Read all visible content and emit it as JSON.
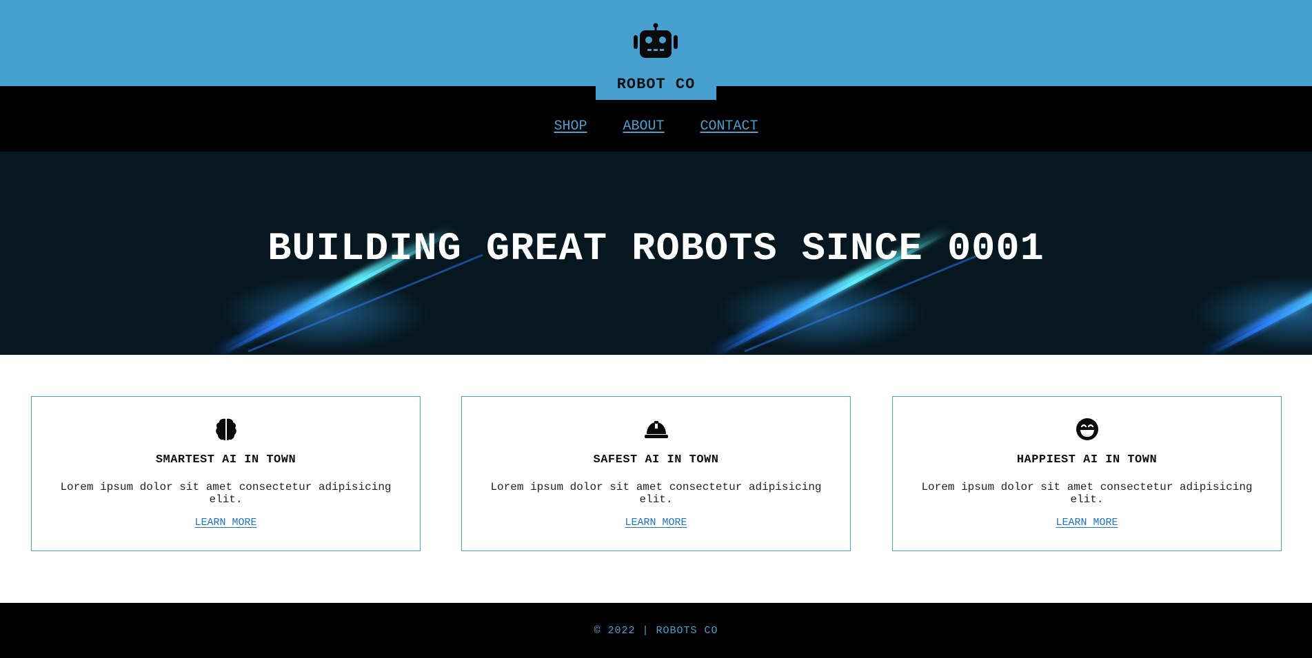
{
  "header": {
    "logo_icon": "robot-icon",
    "brand": "ROBOT CO",
    "background_color": "#47a0d0"
  },
  "nav": {
    "items": [
      {
        "label": "SHOP"
      },
      {
        "label": "ABOUT"
      },
      {
        "label": "CONTACT"
      }
    ],
    "link_color": "#47a0d0"
  },
  "hero": {
    "title": "BUILDING GREAT ROBOTS SINCE 0001"
  },
  "features": {
    "cards": [
      {
        "icon": "brain-icon",
        "title": "SMARTEST AI IN TOWN",
        "text": "Lorem ipsum dolor sit amet consectetur adipisicing elit.",
        "link": "LEARN MORE"
      },
      {
        "icon": "hard-hat-icon",
        "title": "SAFEST AI IN TOWN",
        "text": "Lorem ipsum dolor sit amet consectetur adipisicing elit.",
        "link": "LEARN MORE"
      },
      {
        "icon": "laughing-face-icon",
        "title": "HAPPIEST AI IN TOWN",
        "text": "Lorem ipsum dolor sit amet consectetur adipisicing elit.",
        "link": "LEARN MORE"
      }
    ],
    "border_color": "#47a0d0",
    "link_color": "#1e73c8"
  },
  "footer": {
    "text": "© 2022 | ROBOTS CO"
  }
}
